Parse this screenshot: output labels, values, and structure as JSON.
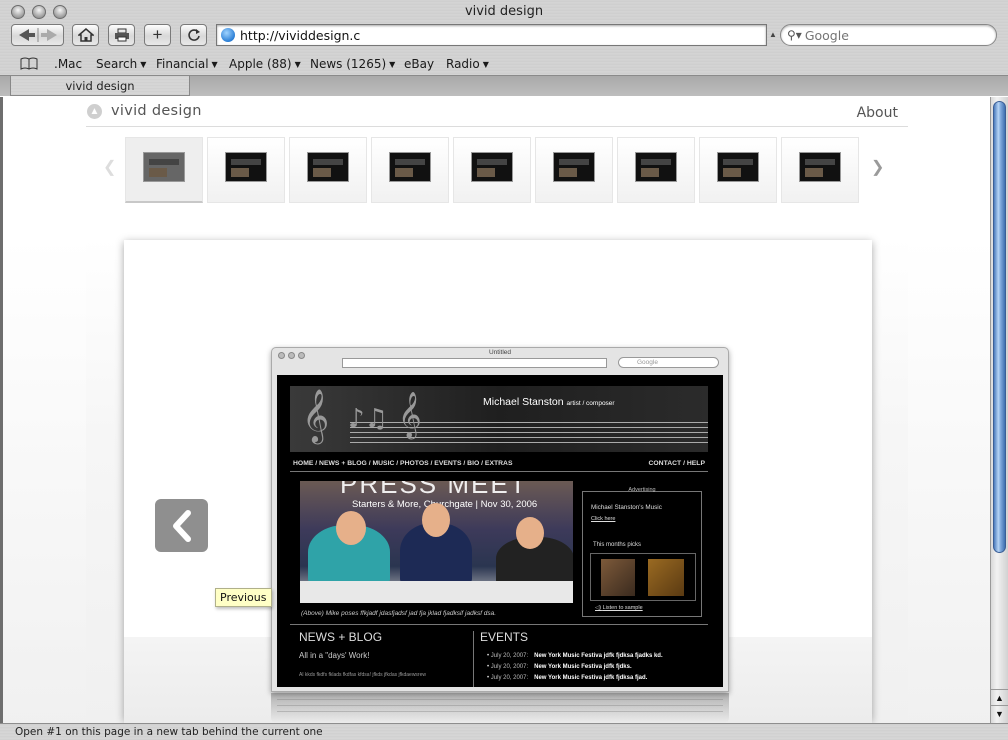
{
  "window": {
    "title": "vivid design"
  },
  "toolbar": {
    "back_icon": "back-arrow-icon",
    "forward_icon": "forward-arrow-icon",
    "home_icon": "home-icon",
    "print_icon": "printer-icon",
    "add_icon": "plus-icon",
    "reload_icon": "reload-icon",
    "url": "http://vividdesign.c",
    "search_placeholder": "Google"
  },
  "bookmarks": [
    {
      "label": ".Mac",
      "menu": false
    },
    {
      "label": "Search",
      "menu": true
    },
    {
      "label": "Financial",
      "menu": true
    },
    {
      "label": "Apple (88)",
      "menu": true
    },
    {
      "label": "News (1265)",
      "menu": true
    },
    {
      "label": "eBay",
      "menu": false
    },
    {
      "label": "Radio",
      "menu": true
    }
  ],
  "tab": {
    "label": "vivid design"
  },
  "site": {
    "name": "vivid design",
    "about": "About",
    "thumbnail_count": 9,
    "active_thumbnail": 1,
    "tooltip": "Previous"
  },
  "mini_browser": {
    "title": "Untitled",
    "search_placeholder": "Google",
    "site": {
      "name": "Michael Stanston",
      "role": "artist / composer",
      "nav_left": "HOME  /  NEWS + BLOG  /  MUSIC  /  PHOTOS  /  EVENTS  /  BIO  /  EXTRAS",
      "nav_right": "CONTACT  /  HELP",
      "photo_headline": "PRESS MEET",
      "photo_subtitle": "Starters & More, Churchgate  |  Nov 30, 2006",
      "caption": "(Above) Mike poses ffkjadf jdasfjadsf jad fja jklad fjadksif jadksf dsa.",
      "ad_label": "Advertising",
      "ad_title": "Michael Stanston's Music",
      "ad_link": "Click here",
      "picks_label": "This months picks",
      "listen": "Listen to sample",
      "news_heading": "NEWS + BLOG",
      "news_sub": "All in a \"days' Work!",
      "news_body": "Al  kkds fkdfs fklads fkdfas kfdsa! jfkds jfkdas jfkdaewsrew",
      "events_heading": "EVENTS",
      "events": [
        {
          "date": "July 20, 2007:",
          "text": "New York Music Festiva jdfk fjdksa fjadks kd."
        },
        {
          "date": "July 20, 2007:",
          "text": "New York Music Festiva jdfk fjdks."
        },
        {
          "date": "July 20, 2007:",
          "text": "New York Music Festiva jdfk fjdksa fjad."
        }
      ]
    }
  },
  "status": {
    "text": "Open #1 on this page in a new tab behind the current one"
  }
}
